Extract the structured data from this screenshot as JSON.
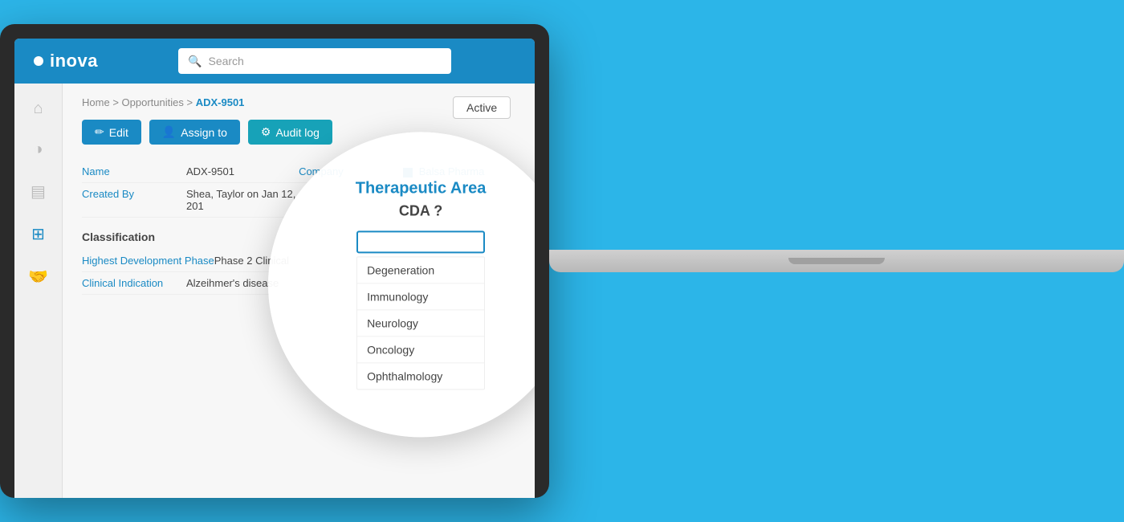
{
  "brand": {
    "name": "inova",
    "logo_dot": "●"
  },
  "header": {
    "search_placeholder": "Search"
  },
  "breadcrumb": {
    "home": "Home",
    "separator": ">",
    "opportunities": "Opportunities",
    "current": "ADX-9501"
  },
  "status": {
    "label": "Active"
  },
  "actions": {
    "edit": "Edit",
    "assign_to": "Assign to",
    "audit_log": "Audit log"
  },
  "record": {
    "name_label": "Name",
    "name_value": "ADX-9501",
    "company_label": "Company",
    "company_value": "Balsa Pharma",
    "created_by_label": "Created By",
    "created_by_value": "Shea, Taylor on Jan 12, 201",
    "classification_label": "Classification",
    "highest_dev_label": "Highest Development Phase",
    "highest_dev_value": "Phase 2 Clinical",
    "clinical_indication_label": "Clinical Indication",
    "clinical_indication_value": "Alzeihmer's disease"
  },
  "zoom": {
    "title": "Therapeutic Area",
    "subtitle": "CDA ?",
    "search_placeholder": "",
    "dropdown_items": [
      "Degeneration",
      "Immunology",
      "Neurology",
      "Oncology",
      "Ophthalmology"
    ]
  },
  "sidebar": {
    "icons": [
      {
        "name": "home-icon",
        "unicode": "⌂",
        "active": false
      },
      {
        "name": "chart-icon",
        "unicode": "◑",
        "active": false
      },
      {
        "name": "contacts-icon",
        "unicode": "▤",
        "active": false
      },
      {
        "name": "network-icon",
        "unicode": "⊞",
        "active": true
      },
      {
        "name": "handshake-icon",
        "unicode": "⊂⊃",
        "active": false
      }
    ]
  }
}
